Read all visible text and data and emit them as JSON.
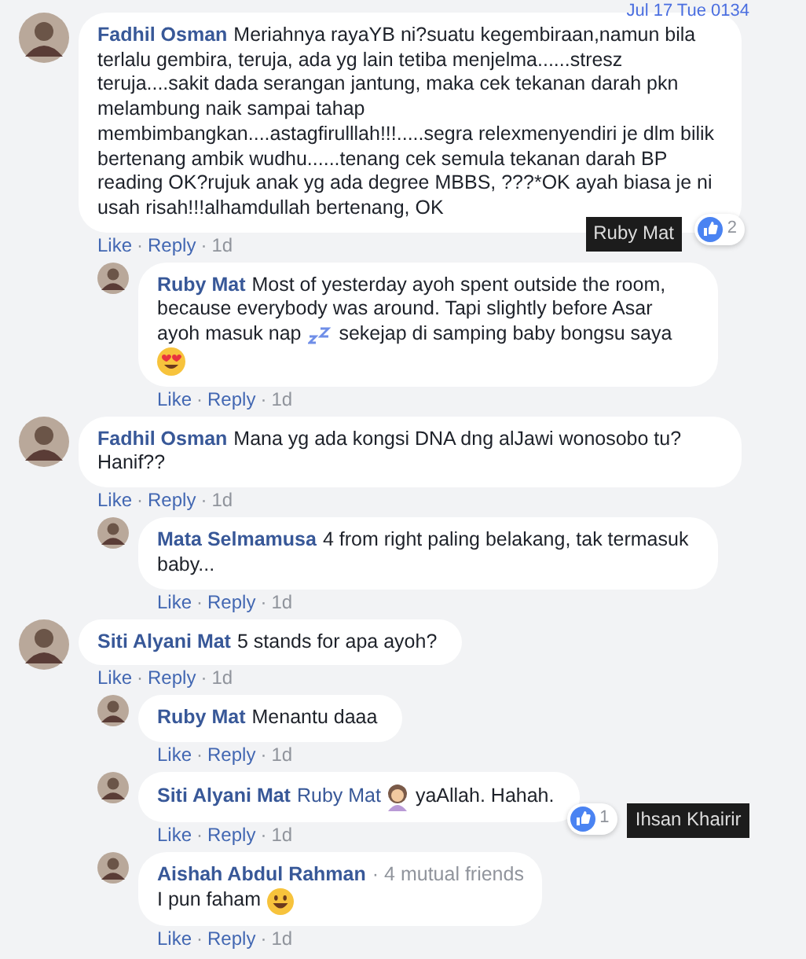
{
  "timestamp": "Jul 17 Tue 0134",
  "comments": [
    {
      "author": "Fadhil Osman",
      "body": [
        {
          "kind": "text",
          "value": "Meriahnya rayaYB ni?suatu kegembiraan,namun bila terlalu gembira, teruja, ada yg lain tetiba menjelma......stresz teruja....sakit dada serangan jantung, maka cek tekanan darah pkn melambung naik sampai tahap membimbangkan....astagfirulllah!!!.....segra relexmenyendiri je dlm bilik bertenang ambik wudhu......tenang cek semula tekanan darah BP reading OK?rujuk anak yg ada degree MBBS, ???*OK ayah biasa je ni usah risah!!!alhamdullah bertenang, OK"
        }
      ],
      "reactions": {
        "count": "2",
        "tooltip": "Ruby Mat"
      },
      "actions": [
        {
          "kind": "link",
          "label": "Like"
        },
        {
          "kind": "dot",
          "label": "·"
        },
        {
          "kind": "link",
          "label": "Reply"
        },
        {
          "kind": "dot",
          "label": "·"
        },
        {
          "kind": "time",
          "label": "1d"
        }
      ],
      "replies": [
        {
          "author": "Ruby Mat",
          "body": [
            {
              "kind": "text",
              "value": "Most of yesterday ayoh spent outside the room, because everybody was around. Tapi slightly before Asar ayoh masuk nap"
            },
            {
              "kind": "sleep"
            },
            {
              "kind": "text",
              "value": "sekejap di samping baby bongsu saya"
            },
            {
              "kind": "heart-eyes"
            }
          ],
          "actions": [
            {
              "kind": "link",
              "label": "Like"
            },
            {
              "kind": "dot",
              "label": "·"
            },
            {
              "kind": "link",
              "label": "Reply"
            },
            {
              "kind": "dot",
              "label": "·"
            },
            {
              "kind": "time",
              "label": "1d"
            }
          ]
        }
      ]
    },
    {
      "author": "Fadhil Osman",
      "body": [
        {
          "kind": "text",
          "value": "Mana yg ada kongsi DNA dng alJawi wonosobo tu?Hanif??"
        }
      ],
      "actions": [
        {
          "kind": "link",
          "label": "Like"
        },
        {
          "kind": "dot",
          "label": "·"
        },
        {
          "kind": "link",
          "label": "Reply"
        },
        {
          "kind": "dot",
          "label": "·"
        },
        {
          "kind": "time",
          "label": "1d"
        }
      ],
      "replies": [
        {
          "author": "Mata Selmamusa",
          "body": [
            {
              "kind": "text",
              "value": "4 from right paling belakang, tak termasuk baby..."
            }
          ],
          "actions": [
            {
              "kind": "link",
              "label": "Like"
            },
            {
              "kind": "dot",
              "label": "·"
            },
            {
              "kind": "link",
              "label": "Reply"
            },
            {
              "kind": "dot",
              "label": "·"
            },
            {
              "kind": "time",
              "label": "1d"
            }
          ]
        }
      ]
    },
    {
      "author": "Siti Alyani Mat",
      "body": [
        {
          "kind": "text",
          "value": "5 stands for apa ayoh?"
        }
      ],
      "actions": [
        {
          "kind": "link",
          "label": "Like"
        },
        {
          "kind": "dot",
          "label": "·"
        },
        {
          "kind": "link",
          "label": "Reply"
        },
        {
          "kind": "dot",
          "label": "·"
        },
        {
          "kind": "time",
          "label": "1d"
        }
      ],
      "replies": [
        {
          "author": "Ruby Mat",
          "body": [
            {
              "kind": "text",
              "value": "Menantu daaa"
            }
          ],
          "actions": [
            {
              "kind": "link",
              "label": "Like"
            },
            {
              "kind": "dot",
              "label": "·"
            },
            {
              "kind": "link",
              "label": "Reply"
            },
            {
              "kind": "dot",
              "label": "·"
            },
            {
              "kind": "time",
              "label": "1d"
            }
          ]
        },
        {
          "author": "Siti Alyani Mat",
          "body": [
            {
              "kind": "mention",
              "value": "Ruby Mat"
            },
            {
              "kind": "woman"
            },
            {
              "kind": "text",
              "value": "yaAllah. Hahah."
            }
          ],
          "reactions": {
            "count": "1",
            "tooltip": "Ihsan Khairir"
          },
          "actions": [
            {
              "kind": "link",
              "label": "Like"
            },
            {
              "kind": "dot",
              "label": "·"
            },
            {
              "kind": "link",
              "label": "Reply"
            },
            {
              "kind": "dot",
              "label": "·"
            },
            {
              "kind": "time",
              "label": "1d"
            }
          ]
        },
        {
          "author": "Aishah Abdul Rahman",
          "mutual": "· 4 mutual friends",
          "body": [
            {
              "kind": "text",
              "value": "I pun faham"
            },
            {
              "kind": "grin"
            }
          ],
          "actions": [
            {
              "kind": "link",
              "label": "Like"
            },
            {
              "kind": "dot",
              "label": "·"
            },
            {
              "kind": "link",
              "label": "Reply"
            },
            {
              "kind": "dot",
              "label": "·"
            },
            {
              "kind": "time",
              "label": "1d"
            }
          ]
        }
      ]
    }
  ]
}
